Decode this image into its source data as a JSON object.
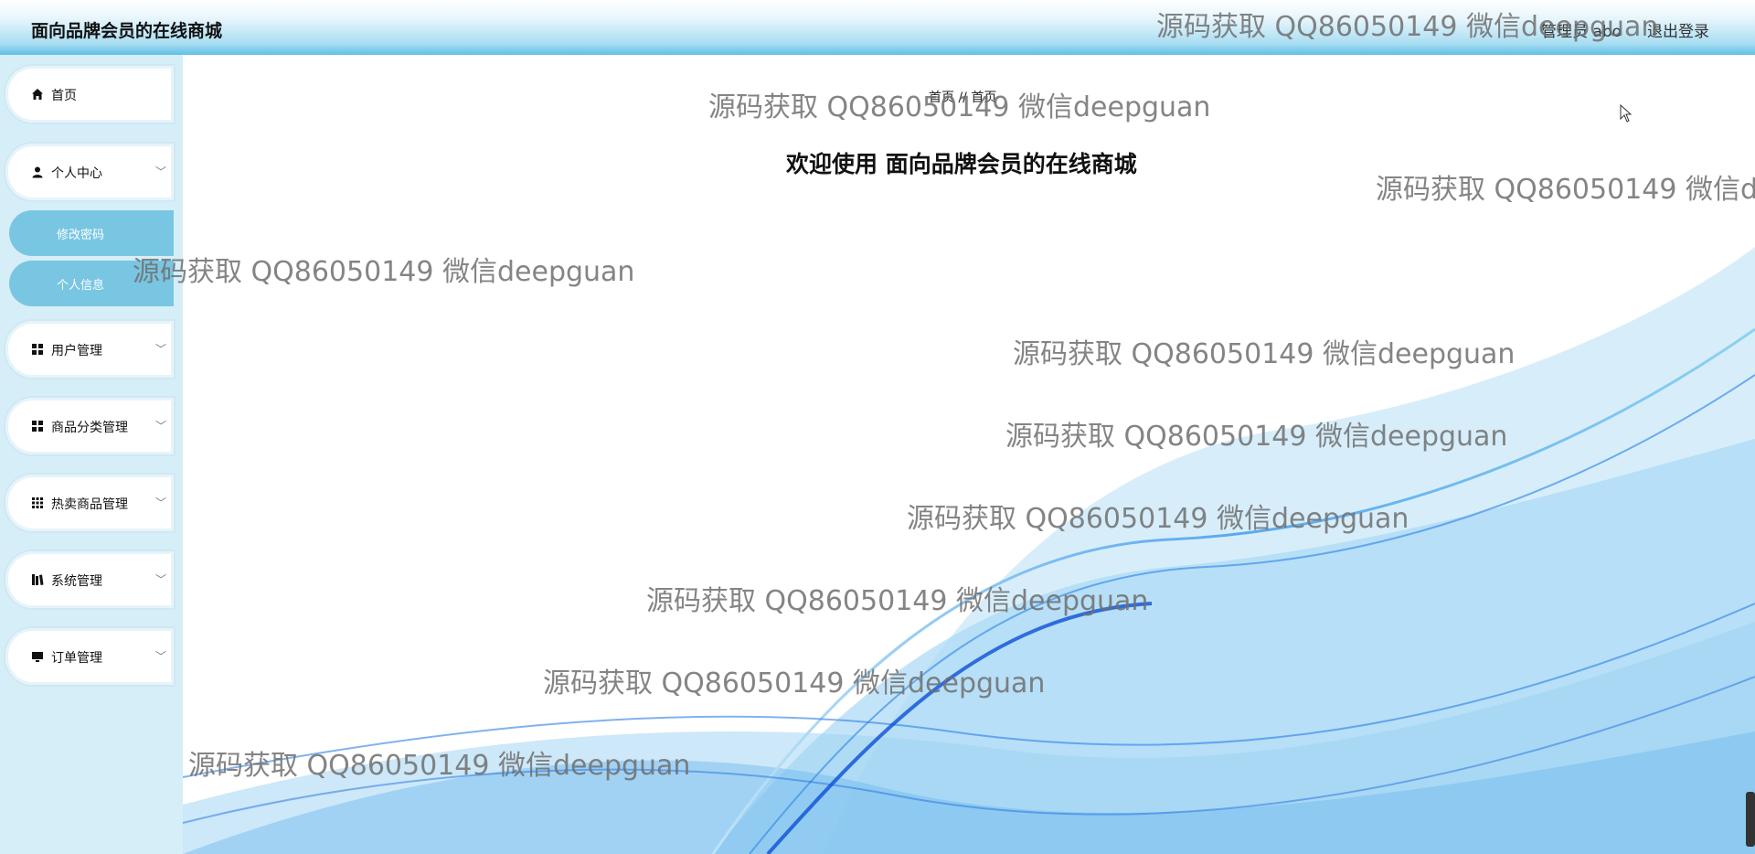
{
  "header": {
    "title": "面向品牌会员的在线商城",
    "user": "管理员 abo",
    "logout": "退出登录"
  },
  "sidebar": {
    "items": [
      {
        "label": "首页",
        "icon": "home-icon"
      },
      {
        "label": "个人中心",
        "icon": "user-icon",
        "subitems": [
          {
            "label": "修改密码"
          },
          {
            "label": "个人信息"
          }
        ]
      },
      {
        "label": "用户管理",
        "icon": "grid-icon"
      },
      {
        "label": "商品分类管理",
        "icon": "grid-icon"
      },
      {
        "label": "热卖商品管理",
        "icon": "apps-icon"
      },
      {
        "label": "系统管理",
        "icon": "books-icon"
      },
      {
        "label": "订单管理",
        "icon": "monitor-icon"
      }
    ]
  },
  "main": {
    "breadcrumb": [
      "首页",
      "//",
      "首页"
    ],
    "welcome": "欢迎使用 面向品牌会员的在线商城"
  },
  "watermark": "源码获取 QQ86050149 微信deepguan",
  "colors": {
    "sidebar_bg": "#d6eef7",
    "submenu_bg": "#79c6e3",
    "header_gradient_end": "#5fbfe6",
    "wave_blue": "#1a73e8"
  }
}
